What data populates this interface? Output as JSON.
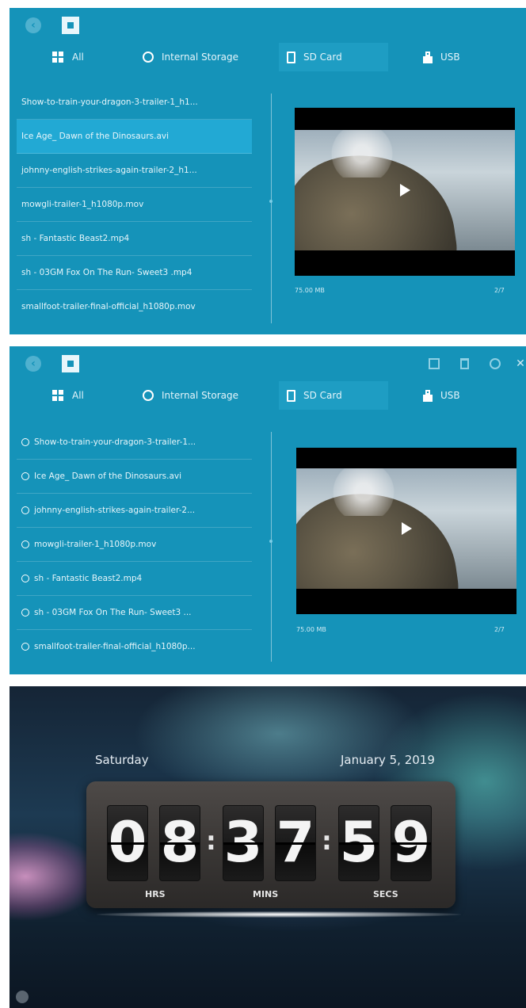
{
  "screen1": {
    "tabs": [
      "All",
      "Internal Storage",
      "SD Card",
      "USB"
    ],
    "files": [
      "Show-to-train-your-dragon-3-trailer-1_h1...",
      "Ice Age_ Dawn of the Dinosaurs.avi",
      "johnny-english-strikes-again-trailer-2_h1...",
      "mowgli-trailer-1_h1080p.mov",
      "sh - Fantastic Beast2.mp4",
      "sh - 03GM Fox On The Run- Sweet3 .mp4",
      "smallfoot-trailer-final-official_h1080p.mov"
    ],
    "file_size": "75.00 MB",
    "file_index": "2/7"
  },
  "screen2": {
    "tabs": [
      "All",
      "Internal Storage",
      "SD Card",
      "USB"
    ],
    "files": [
      "Show-to-train-your-dragon-3-trailer-1...",
      "Ice Age_ Dawn of the Dinosaurs.avi",
      "johnny-english-strikes-again-trailer-2...",
      "mowgli-trailer-1_h1080p.mov",
      "sh - Fantastic Beast2.mp4",
      "sh - 03GM Fox On The Run- Sweet3 ...",
      "smallfoot-trailer-final-official_h1080p..."
    ],
    "file_size": "75.00 MB",
    "file_index": "2/7"
  },
  "clock": {
    "day": "Saturday",
    "date": "January 5, 2019",
    "hours": [
      "0",
      "8"
    ],
    "minutes": [
      "3",
      "7"
    ],
    "seconds": [
      "5",
      "9"
    ],
    "hrs_label": "HRS",
    "mins_label": "MINS",
    "secs_label": "SECS"
  },
  "colors": {
    "panel_blue": "#1593b9",
    "selected_row": "#22a9d4"
  },
  "icons": [
    "back-icon",
    "app-icon",
    "all-grid-icon",
    "internal-storage-icon",
    "sd-card-icon",
    "usb-icon",
    "play-icon",
    "copy-icon",
    "delete-icon",
    "select-all-icon",
    "close-icon",
    "settings-icon"
  ]
}
